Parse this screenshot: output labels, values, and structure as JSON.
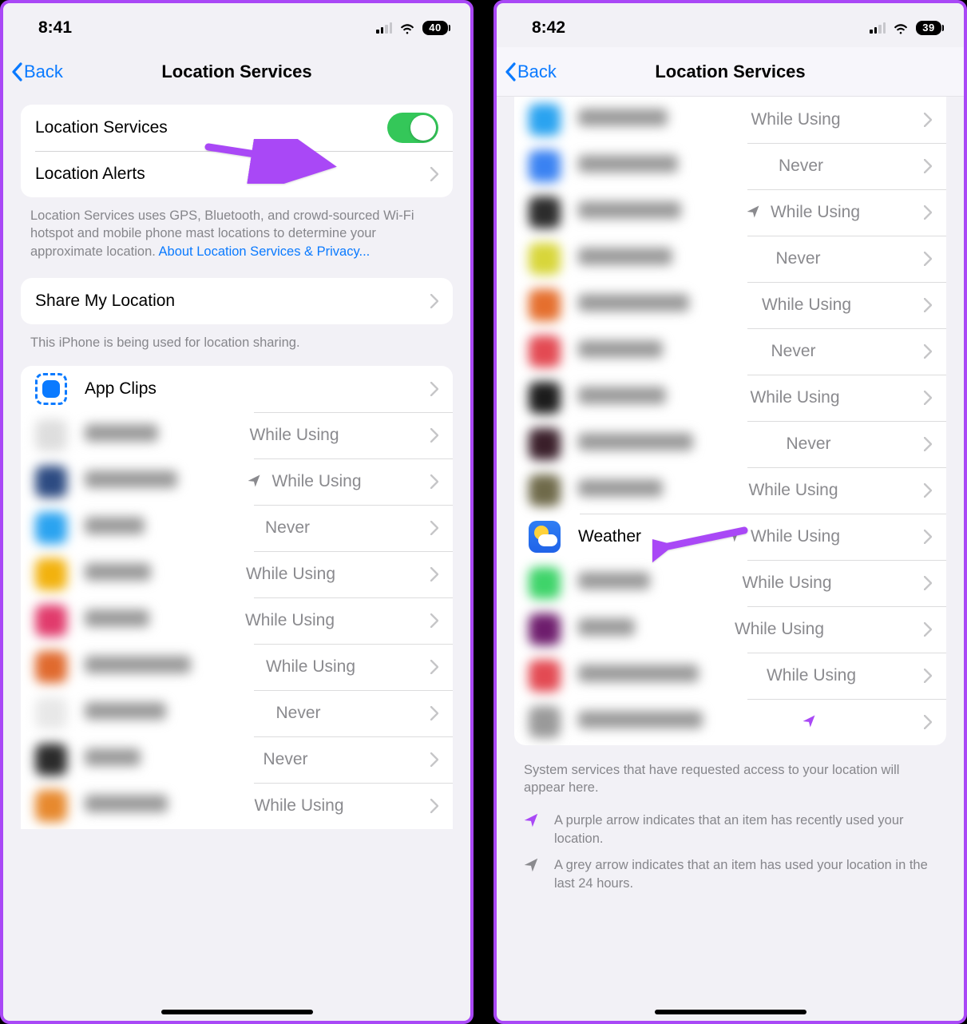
{
  "left": {
    "status": {
      "time": "8:41",
      "battery": "40"
    },
    "nav": {
      "back": "Back",
      "title": "Location Services"
    },
    "group1": {
      "location_services": "Location Services",
      "location_alerts": "Location Alerts"
    },
    "footer1_pre": "Location Services uses GPS, Bluetooth, and crowd-sourced Wi-Fi hotspot and mobile phone mast locations to determine your approximate location. ",
    "footer1_link": "About Location Services & Privacy...",
    "group2": {
      "share": "Share My Location"
    },
    "footer2": "This iPhone is being used for location sharing.",
    "apps": [
      {
        "label": "App Clips",
        "detail": "",
        "icon": "appclips",
        "blur": false,
        "arrow": "none"
      },
      {
        "label": "Blurred",
        "detail": "While Using",
        "color": "#dedede",
        "blur": true,
        "arrow": "none"
      },
      {
        "label": "Blurred",
        "detail": "While Using",
        "color": "#2d4b82",
        "blur": true,
        "arrow": "gray"
      },
      {
        "label": "Blurred",
        "detail": "Never",
        "color": "#2aa3f0",
        "blur": true,
        "arrow": "none"
      },
      {
        "label": "Blurred",
        "detail": "While Using",
        "color": "#f2b20e",
        "blur": true,
        "arrow": "none"
      },
      {
        "label": "Blurred",
        "detail": "While Using",
        "color": "#e13b6c",
        "blur": true,
        "arrow": "none"
      },
      {
        "label": "Blurred",
        "detail": "While Using",
        "color": "#e06a2e",
        "blur": true,
        "arrow": "none"
      },
      {
        "label": "Blurred",
        "detail": "Never",
        "color": "#e8e8e8",
        "blur": true,
        "arrow": "none"
      },
      {
        "label": "Blurred",
        "detail": "Never",
        "color": "#2b2b2b",
        "blur": true,
        "arrow": "none"
      },
      {
        "label": "Blurred",
        "detail": "While Using",
        "color": "#e7892e",
        "blur": true,
        "arrow": "none"
      }
    ]
  },
  "right": {
    "status": {
      "time": "8:42",
      "battery": "39"
    },
    "nav": {
      "back": "Back",
      "title": "Location Services"
    },
    "apps": [
      {
        "label": "Blurred",
        "detail": "While Using",
        "color": "#2aa3f0",
        "blur": true,
        "arrow": "none"
      },
      {
        "label": "Blurred",
        "detail": "Never",
        "color": "#3a82f2",
        "blur": true,
        "arrow": "none"
      },
      {
        "label": "Blurred",
        "detail": "While Using",
        "color": "#2c2c2c",
        "blur": true,
        "arrow": "gray"
      },
      {
        "label": "Blurred",
        "detail": "Never",
        "color": "#d8d63a",
        "blur": true,
        "arrow": "none"
      },
      {
        "label": "Blurred",
        "detail": "While Using",
        "color": "#e56f2e",
        "blur": true,
        "arrow": "none"
      },
      {
        "label": "Blurred",
        "detail": "Never",
        "color": "#e34a53",
        "blur": true,
        "arrow": "none"
      },
      {
        "label": "Blurred",
        "detail": "While Using",
        "color": "#1c1c1c",
        "blur": true,
        "arrow": "none"
      },
      {
        "label": "Blurred",
        "detail": "Never",
        "color": "#3a1f2a",
        "blur": true,
        "arrow": "none"
      },
      {
        "label": "Blurred",
        "detail": "While Using",
        "color": "#6f6a4a",
        "blur": true,
        "arrow": "none"
      },
      {
        "label": "Weather",
        "detail": "While Using",
        "icon": "weather",
        "blur": false,
        "arrow": "gray"
      },
      {
        "label": "Blurred",
        "detail": "While Using",
        "color": "#3fd46a",
        "blur": true,
        "arrow": "none"
      },
      {
        "label": "Blurred",
        "detail": "While Using",
        "color": "#6e1d6d",
        "blur": true,
        "arrow": "none"
      },
      {
        "label": "Blurred",
        "detail": "While Using",
        "color": "#e34a53",
        "blur": true,
        "arrow": "none"
      },
      {
        "label": "Blurred",
        "detail": "",
        "color": "#9a9a9a",
        "blur": true,
        "arrow": "purple"
      }
    ],
    "footer1": "System services that have requested access to your location will appear here.",
    "legend_purple": "A purple arrow indicates that an item has recently used your location.",
    "legend_gray": "A grey arrow indicates that an item has used your location in the last 24 hours."
  }
}
